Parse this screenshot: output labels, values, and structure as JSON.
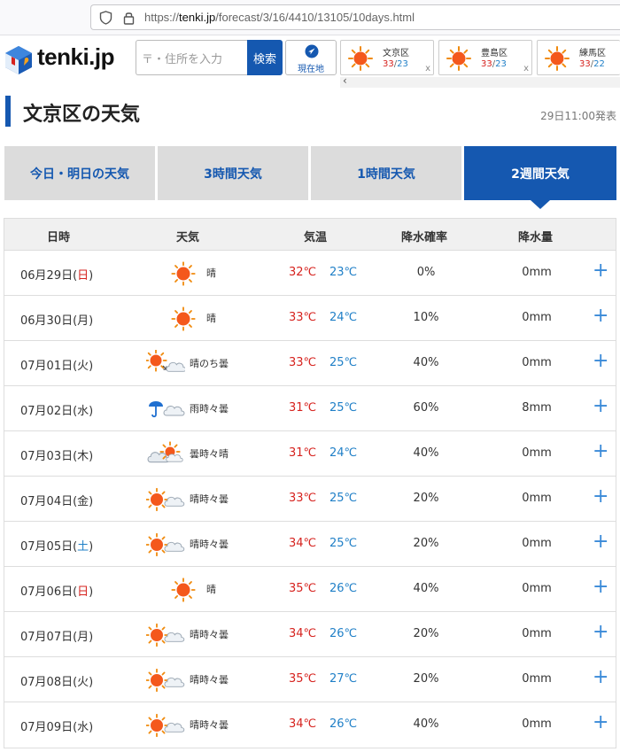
{
  "browser": {
    "url_prefix": "https://",
    "url_host": "tenki.jp",
    "url_path": "/forecast/3/16/4410/13105/10days.html"
  },
  "header": {
    "logo_text": "tenki.jp",
    "search_placeholder": "〒・住所を入力",
    "search_label": "検索",
    "locate_label": "現在地",
    "cities": [
      {
        "name": "文京区",
        "high": "33",
        "low": "23",
        "close": "x"
      },
      {
        "name": "豊島区",
        "high": "33",
        "low": "23",
        "close": "x"
      },
      {
        "name": "練馬区",
        "high": "33",
        "low": "22",
        "close": ""
      }
    ],
    "scroll_left": "‹"
  },
  "page": {
    "title": "文京区の天気",
    "issued": "29日11:00発表"
  },
  "tabs": [
    {
      "label": "今日・明日の天気",
      "active": false
    },
    {
      "label": "3時間天気",
      "active": false
    },
    {
      "label": "1時間天気",
      "active": false
    },
    {
      "label": "2週間天気",
      "active": true
    }
  ],
  "table": {
    "headers": {
      "date": "日時",
      "weather": "天気",
      "temp": "気温",
      "prob": "降水確率",
      "amount": "降水量"
    },
    "rows": [
      {
        "date": "06月29日(",
        "day": "日",
        "day_type": "sun",
        "icon": "sunny",
        "weather": "晴",
        "high": "32℃",
        "low": "23℃",
        "prob": "0%",
        "amount": "0mm"
      },
      {
        "date": "06月30日(",
        "day": "月",
        "day_type": "week",
        "icon": "sunny",
        "weather": "晴",
        "high": "33℃",
        "low": "24℃",
        "prob": "10%",
        "amount": "0mm"
      },
      {
        "date": "07月01日(",
        "day": "火",
        "day_type": "week",
        "icon": "sunny-then-cloudy",
        "weather": "晴のち曇",
        "high": "33℃",
        "low": "25℃",
        "prob": "40%",
        "amount": "0mm"
      },
      {
        "date": "07月02日(",
        "day": "水",
        "day_type": "week",
        "icon": "rain-sometimes-cloudy",
        "weather": "雨時々曇",
        "high": "31℃",
        "low": "25℃",
        "prob": "60%",
        "amount": "8mm"
      },
      {
        "date": "07月03日(",
        "day": "木",
        "day_type": "week",
        "icon": "cloudy-sometimes-sunny",
        "weather": "曇時々晴",
        "high": "31℃",
        "low": "24℃",
        "prob": "40%",
        "amount": "0mm"
      },
      {
        "date": "07月04日(",
        "day": "金",
        "day_type": "week",
        "icon": "sunny-sometimes-cloudy",
        "weather": "晴時々曇",
        "high": "33℃",
        "low": "25℃",
        "prob": "20%",
        "amount": "0mm"
      },
      {
        "date": "07月05日(",
        "day": "土",
        "day_type": "sat",
        "icon": "sunny-sometimes-cloudy",
        "weather": "晴時々曇",
        "high": "34℃",
        "low": "25℃",
        "prob": "20%",
        "amount": "0mm"
      },
      {
        "date": "07月06日(",
        "day": "日",
        "day_type": "sun",
        "icon": "sunny",
        "weather": "晴",
        "high": "35℃",
        "low": "26℃",
        "prob": "40%",
        "amount": "0mm"
      },
      {
        "date": "07月07日(",
        "day": "月",
        "day_type": "week",
        "icon": "sunny-sometimes-cloudy",
        "weather": "晴時々曇",
        "high": "34℃",
        "low": "26℃",
        "prob": "20%",
        "amount": "0mm"
      },
      {
        "date": "07月08日(",
        "day": "火",
        "day_type": "week",
        "icon": "sunny-sometimes-cloudy",
        "weather": "晴時々曇",
        "high": "35℃",
        "low": "27℃",
        "prob": "20%",
        "amount": "0mm"
      },
      {
        "date": "07月09日(",
        "day": "水",
        "day_type": "week",
        "icon": "sunny-sometimes-cloudy",
        "weather": "晴時々曇",
        "high": "34℃",
        "low": "26℃",
        "prob": "40%",
        "amount": "0mm"
      }
    ],
    "expand_label": "+"
  },
  "colors": {
    "accent": "#1558b0",
    "high_temp": "#d6221e",
    "low_temp": "#1f7fc7",
    "plus": "#3a8ad8"
  }
}
